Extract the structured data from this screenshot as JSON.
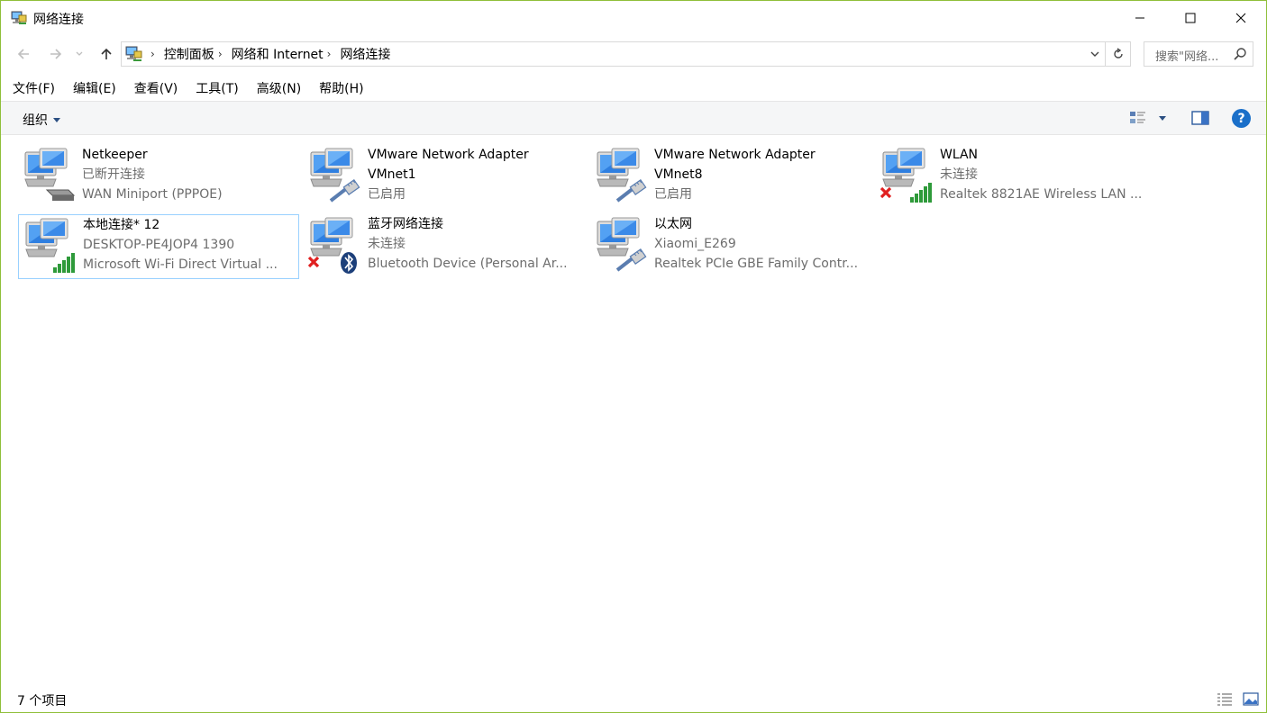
{
  "window": {
    "title": "网络连接",
    "icon": "network-connections-icon"
  },
  "nav": {
    "breadcrumb": [
      "控制面板",
      "网络和 Internet",
      "网络连接"
    ],
    "search_placeholder": "搜索\"网络...",
    "back_icon": "arrow-left-icon",
    "forward_icon": "arrow-right-icon",
    "up_icon": "arrow-up-icon",
    "refresh_icon": "refresh-icon",
    "search_icon": "search-icon"
  },
  "menu": [
    "文件(F)",
    "编辑(E)",
    "查看(V)",
    "工具(T)",
    "高级(N)",
    "帮助(H)"
  ],
  "commandbar": {
    "organize_label": "组织",
    "help_label": "?"
  },
  "items": [
    {
      "name": "Netkeeper",
      "line2": "已断开连接",
      "line3": "WAN Miniport (PPPOE)",
      "icon": "modem-connection-icon",
      "status": "disconnected"
    },
    {
      "name": "VMware Network Adapter VMnet1",
      "line2": "已启用",
      "line3": "",
      "icon": "ethernet-connection-icon",
      "status": "enabled"
    },
    {
      "name": "VMware Network Adapter VMnet8",
      "line2": "已启用",
      "line3": "",
      "icon": "ethernet-connection-icon",
      "status": "enabled"
    },
    {
      "name": "WLAN",
      "line2": "未连接",
      "line3": "Realtek 8821AE Wireless LAN ...",
      "icon": "wifi-connection-icon",
      "status": "not-connected"
    },
    {
      "name": "本地连接* 12",
      "line2": "DESKTOP-PE4JOP4 1390",
      "line3": "Microsoft Wi-Fi Direct Virtual ...",
      "icon": "wifi-connection-icon",
      "status": "connected"
    },
    {
      "name": "蓝牙网络连接",
      "line2": "未连接",
      "line3": "Bluetooth Device (Personal Ar...",
      "icon": "bluetooth-connection-icon",
      "status": "not-connected"
    },
    {
      "name": "以太网",
      "line2": "Xiaomi_E269",
      "line3": "Realtek PCIe GBE Family Contr...",
      "icon": "ethernet-connection-icon",
      "status": "connected"
    }
  ],
  "status": {
    "count": "7 个项目"
  },
  "colors": {
    "window_border": "#8fbf3a",
    "selection_border": "#99d1ff",
    "secondary_text": "#6d6d6d",
    "error_red": "#e02020",
    "signal_green": "#2e9a3a",
    "help_blue": "#1a6fc9"
  }
}
